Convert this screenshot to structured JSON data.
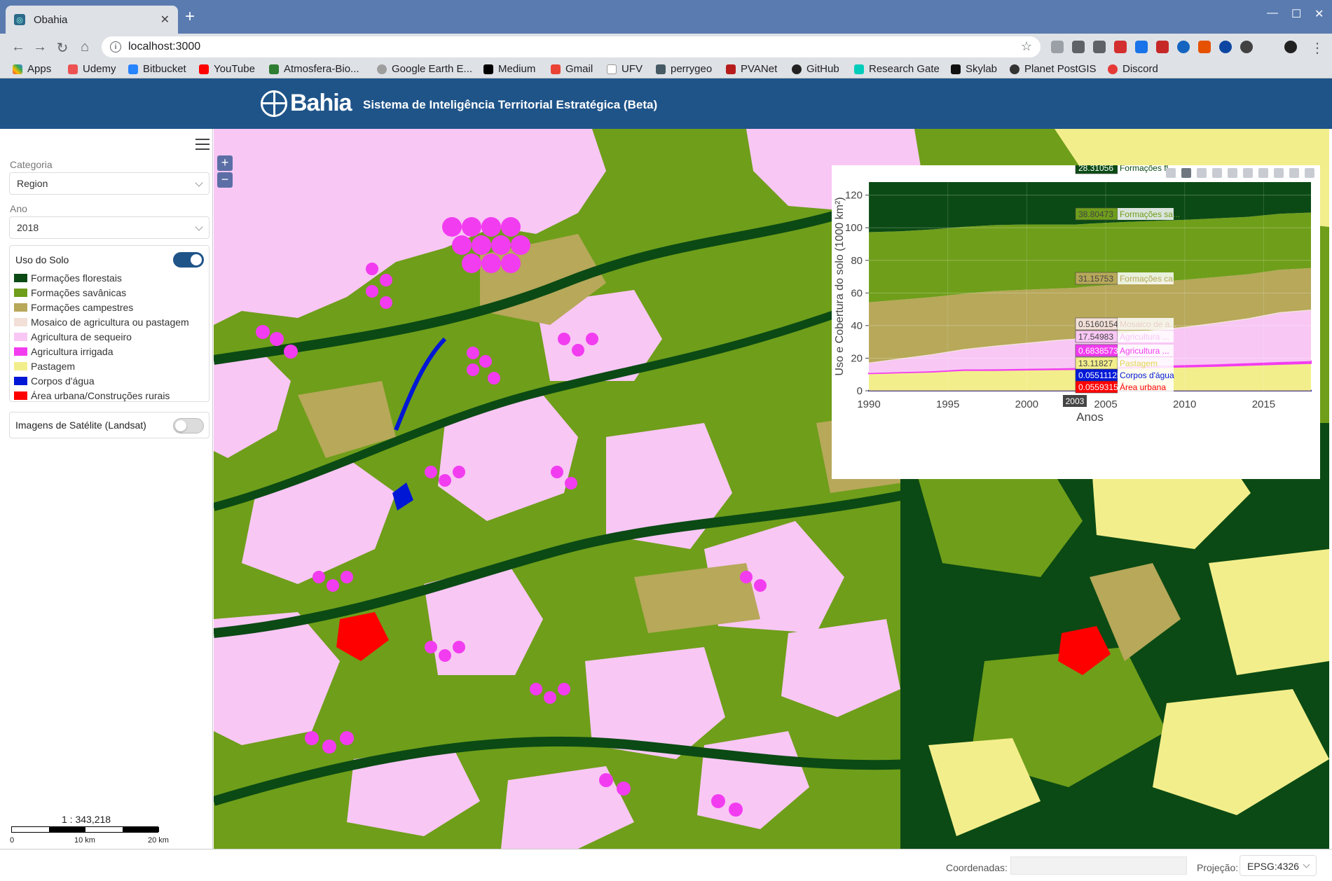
{
  "browser": {
    "tab_title": "Obahia",
    "url": "localhost:3000",
    "bookmarks": [
      "Apps",
      "Udemy",
      "Bitbucket",
      "YouTube",
      "Atmosfera-Bio...",
      "Google Earth E...",
      "Medium",
      "Gmail",
      "UFV",
      "perrygeo",
      "PVANet",
      "GitHub",
      "Research Gate",
      "Skylab",
      "Planet PostGIS",
      "Discord"
    ]
  },
  "header": {
    "brand": "Bahia",
    "subtitle": "Sistema de Inteligência Territorial Estratégica (Beta)"
  },
  "sidebar": {
    "categoria_label": "Categoria",
    "categoria_value": "Region",
    "ano_label": "Ano",
    "ano_value": "2018",
    "uso_title": "Uso do Solo",
    "uso_toggle": true,
    "legend": [
      {
        "label": "Formações florestais",
        "color": "#0b4a14"
      },
      {
        "label": "Formações savânicas",
        "color": "#6f9e1a"
      },
      {
        "label": "Formações campestres",
        "color": "#b7a85a"
      },
      {
        "label": "Mosaico de agricultura ou pastagem",
        "color": "#f2e0d8"
      },
      {
        "label": "Agricultura de sequeiro",
        "color": "#f8c7f4"
      },
      {
        "label": "Agricultura irrigada",
        "color": "#f23cf0"
      },
      {
        "label": "Pastagem",
        "color": "#f3ee8c"
      },
      {
        "label": "Corpos d'água",
        "color": "#0018d6"
      },
      {
        "label": "Área urbana/Construções rurais",
        "color": "#ff0000"
      }
    ],
    "sat_title": "Imagens de Satélite (Landsat)",
    "sat_toggle": false,
    "scale_text": "1 : 343,218",
    "scale_labels": [
      "0",
      "10 km",
      "20 km"
    ]
  },
  "map": {
    "zoom_in": "+",
    "zoom_out": "−"
  },
  "chart_data": {
    "type": "area",
    "xlabel": "Anos",
    "ylabel": "Uso e Cobertura do solo (1000 km²)",
    "xlim": [
      1990,
      2018
    ],
    "ylim": [
      0,
      128
    ],
    "x_ticks": [
      1990,
      1995,
      2000,
      2005,
      2010,
      2015
    ],
    "y_ticks": [
      0,
      20,
      40,
      60,
      80,
      100,
      120
    ],
    "hover_x_label": "2003",
    "hover_x": 2003,
    "x": [
      1990,
      1992,
      1994,
      1996,
      1998,
      2000,
      2002,
      2003,
      2004,
      2006,
      2008,
      2010,
      2012,
      2014,
      2016,
      2018
    ],
    "series": [
      {
        "name": "Área urbana",
        "label": "Área urbana",
        "hover_value": "0.05593159",
        "color": "#ff0000",
        "line": true,
        "values": [
          0.05,
          0.05,
          0.05,
          0.05,
          0.05,
          0.05,
          0.056,
          0.056,
          0.056,
          0.06,
          0.06,
          0.06,
          0.06,
          0.06,
          0.06,
          0.06
        ]
      },
      {
        "name": "Corpos d'água",
        "label": "Corpos d'água",
        "hover_value": "0.05511125",
        "color": "#0018d6",
        "line": true,
        "values": [
          0.05,
          0.05,
          0.05,
          0.05,
          0.05,
          0.05,
          0.055,
          0.055,
          0.055,
          0.06,
          0.06,
          0.06,
          0.06,
          0.06,
          0.06,
          0.06
        ]
      },
      {
        "name": "Pastagem",
        "label": "Pastagem",
        "hover_value": "13.11827",
        "color": "#f3ee8c",
        "values": [
          10.5,
          11,
          11.5,
          12.5,
          12.5,
          12.8,
          13.0,
          13.1,
          13.4,
          13.8,
          14.2,
          14.6,
          15.0,
          15.6,
          16.2,
          16.8
        ]
      },
      {
        "name": "Agricultura irrigada",
        "label": "Agricultura ...",
        "hover_value": "0.6838573",
        "color": "#f23cf0",
        "line": true,
        "values": [
          0.3,
          0.35,
          0.4,
          0.5,
          0.55,
          0.6,
          0.66,
          0.68,
          0.7,
          0.8,
          0.9,
          1.0,
          1.1,
          1.2,
          1.3,
          1.3
        ]
      },
      {
        "name": "Agricultura de sequeiro",
        "label": "Agricultura ...",
        "hover_value": "17.54983",
        "color": "#f8c7f4",
        "values": [
          6,
          8,
          10,
          12,
          14,
          15.5,
          17,
          17.5,
          18.5,
          20,
          21.5,
          23,
          25,
          27,
          30,
          31
        ]
      },
      {
        "name": "Mosaico de agricultura ou pastagem",
        "label": "Mosaico de a...",
        "hover_value": "0.5160154",
        "color": "#f2e0d8",
        "values": [
          0.4,
          0.4,
          0.45,
          0.45,
          0.5,
          0.5,
          0.51,
          0.52,
          0.52,
          0.53,
          0.54,
          0.55,
          0.55,
          0.56,
          0.56,
          0.57
        ]
      },
      {
        "name": "Formações campestres",
        "label": "Formações ca...",
        "hover_value": "31.15753",
        "color": "#b7a85a",
        "values": [
          37,
          36,
          35,
          34,
          33.5,
          32.5,
          31.5,
          31.2,
          30.8,
          30.2,
          29.5,
          28.8,
          28,
          27,
          26,
          25.5
        ]
      },
      {
        "name": "Formações savânicas",
        "label": "Formações sa...",
        "hover_value": "38.80473",
        "color": "#6f9e1a",
        "values": [
          43,
          42,
          41.5,
          41,
          40.5,
          40,
          39.2,
          38.8,
          38.5,
          38,
          37.4,
          36.8,
          36,
          35.2,
          34.4,
          34
        ]
      },
      {
        "name": "Formações florestais",
        "label": "Formações fl...",
        "hover_value": "28.31056",
        "color": "#0b4a14",
        "values": [
          30,
          29.8,
          29.5,
          29.2,
          29,
          28.8,
          28.5,
          28.3,
          28.1,
          27.8,
          27.5,
          27.2,
          26.8,
          26.5,
          26.2,
          26
        ]
      }
    ]
  },
  "status": {
    "coord_label": "Coordenadas:",
    "coord_value": "",
    "proj_label": "Projeção:",
    "proj_value": "EPSG:4326"
  }
}
